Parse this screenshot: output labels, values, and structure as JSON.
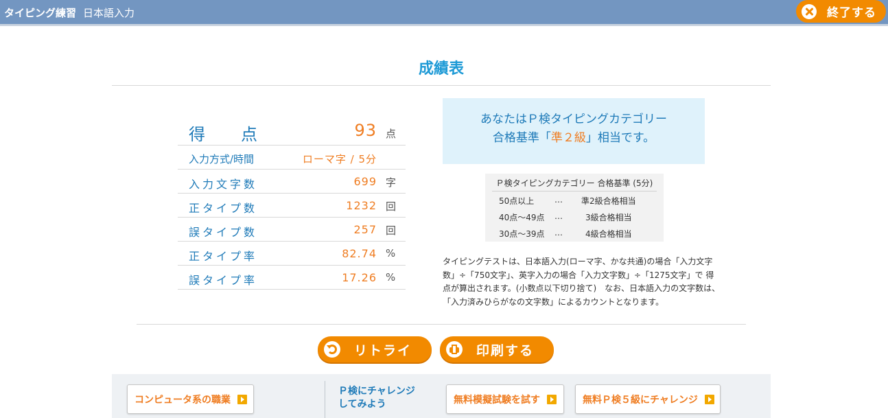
{
  "header": {
    "app_title": "タイピング練習",
    "mode": "日本語入力",
    "end_button": "終了する"
  },
  "page_title": "成績表",
  "score": {
    "rows": [
      {
        "label_a": "得",
        "label_b": "点",
        "value": "93",
        "unit": "点"
      },
      {
        "label": "入力方式/時間",
        "value": "ローマ字 / 5分",
        "unit": ""
      },
      {
        "label": "入力文字数",
        "value": "699",
        "unit": "字"
      },
      {
        "label": "正タイプ数",
        "value": "1232",
        "unit": "回"
      },
      {
        "label": "誤タイプ数",
        "value": "257",
        "unit": "回"
      },
      {
        "label": "正タイプ率",
        "value": "82.74",
        "unit": "%"
      },
      {
        "label": "誤タイプ率",
        "value": "17.26",
        "unit": "%"
      }
    ]
  },
  "result": {
    "line1": "あなたはＰ検タイピングカテゴリー",
    "line2_pre": "合格基準「",
    "grade": "準２級",
    "line2_post": "」相当です。"
  },
  "criteria": {
    "header": "Ｐ検タイピングカテゴリー 合格基準 (5分)",
    "rows": [
      {
        "range": "50点以上",
        "dots": "…",
        "grade": "準2級合格相当"
      },
      {
        "range": "40点〜49点",
        "dots": "…",
        "grade": "3級合格相当"
      },
      {
        "range": "30点〜39点",
        "dots": "…",
        "grade": "4級合格相当"
      }
    ]
  },
  "note": "タイピングテストは、日本語入力(ローマ字、かな共通)の場合「入力文字数」÷「750文字」、英字入力の場合「入力文字数」÷「1275文字」で 得点が算出されます。(小数点以下切り捨て)　なお、日本語入力の文字数は、「入力済みひらがなの文字数」によるカウントとなります。",
  "buttons": {
    "retry": "リトライ",
    "print": "印刷する"
  },
  "footer": {
    "careers": "コンピュータ系の職業",
    "challenge_line1": "Ｐ検にチャレンジ",
    "challenge_line2": "してみよう",
    "mock_exam": "無料模擬試験を試す",
    "grade5": "無料Ｐ検５級にチャレンジ"
  },
  "colors": {
    "header_bg": "#7396c1",
    "accent_orange": "#f28a00",
    "value_orange": "#ef7d22",
    "label_blue": "#1e7ab8",
    "title_blue": "#1e9ad6",
    "result_bg": "#dff2fb"
  }
}
